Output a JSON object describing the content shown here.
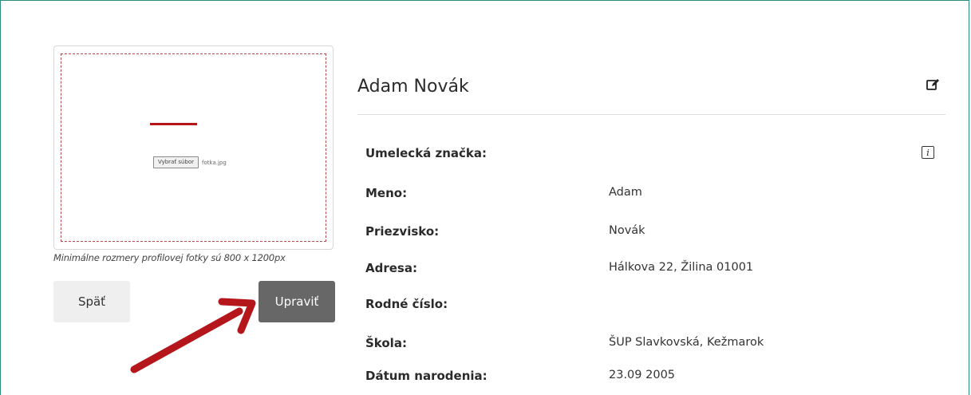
{
  "photo": {
    "choose_file_label": "Vybrať súbor",
    "file_name": "fotka.jpg",
    "hint": "Minimálne rozmery profilovej fotky sú 800 x 1200px"
  },
  "buttons": {
    "back": "Späť",
    "edit": "Upraviť"
  },
  "profile": {
    "name": "Adam Novák",
    "fields": [
      {
        "label": "Umelecká značka:",
        "value": ""
      },
      {
        "label": "Meno:",
        "value": "Adam"
      },
      {
        "label": "Priezvisko:",
        "value": "Novák"
      },
      {
        "label": "Adresa:",
        "value": "Hálkova 22, Žilina 01001"
      },
      {
        "label": "Rodné číslo:",
        "value": ""
      },
      {
        "label": "Škola:",
        "value": "ŠUP Slavkovská, Kežmarok"
      },
      {
        "label": "Dátum narodenia:",
        "value": "23.09 2005"
      }
    ]
  },
  "icons": {
    "edit": "edit-icon",
    "info": "info-icon",
    "annotation_arrow": "arrow-icon"
  },
  "colors": {
    "frame_border": "#2a8c7a",
    "dashed_border": "#b44a4a",
    "annotation_red": "#b5161b",
    "edit_button_bg": "#676767",
    "back_button_bg": "#efefef"
  }
}
